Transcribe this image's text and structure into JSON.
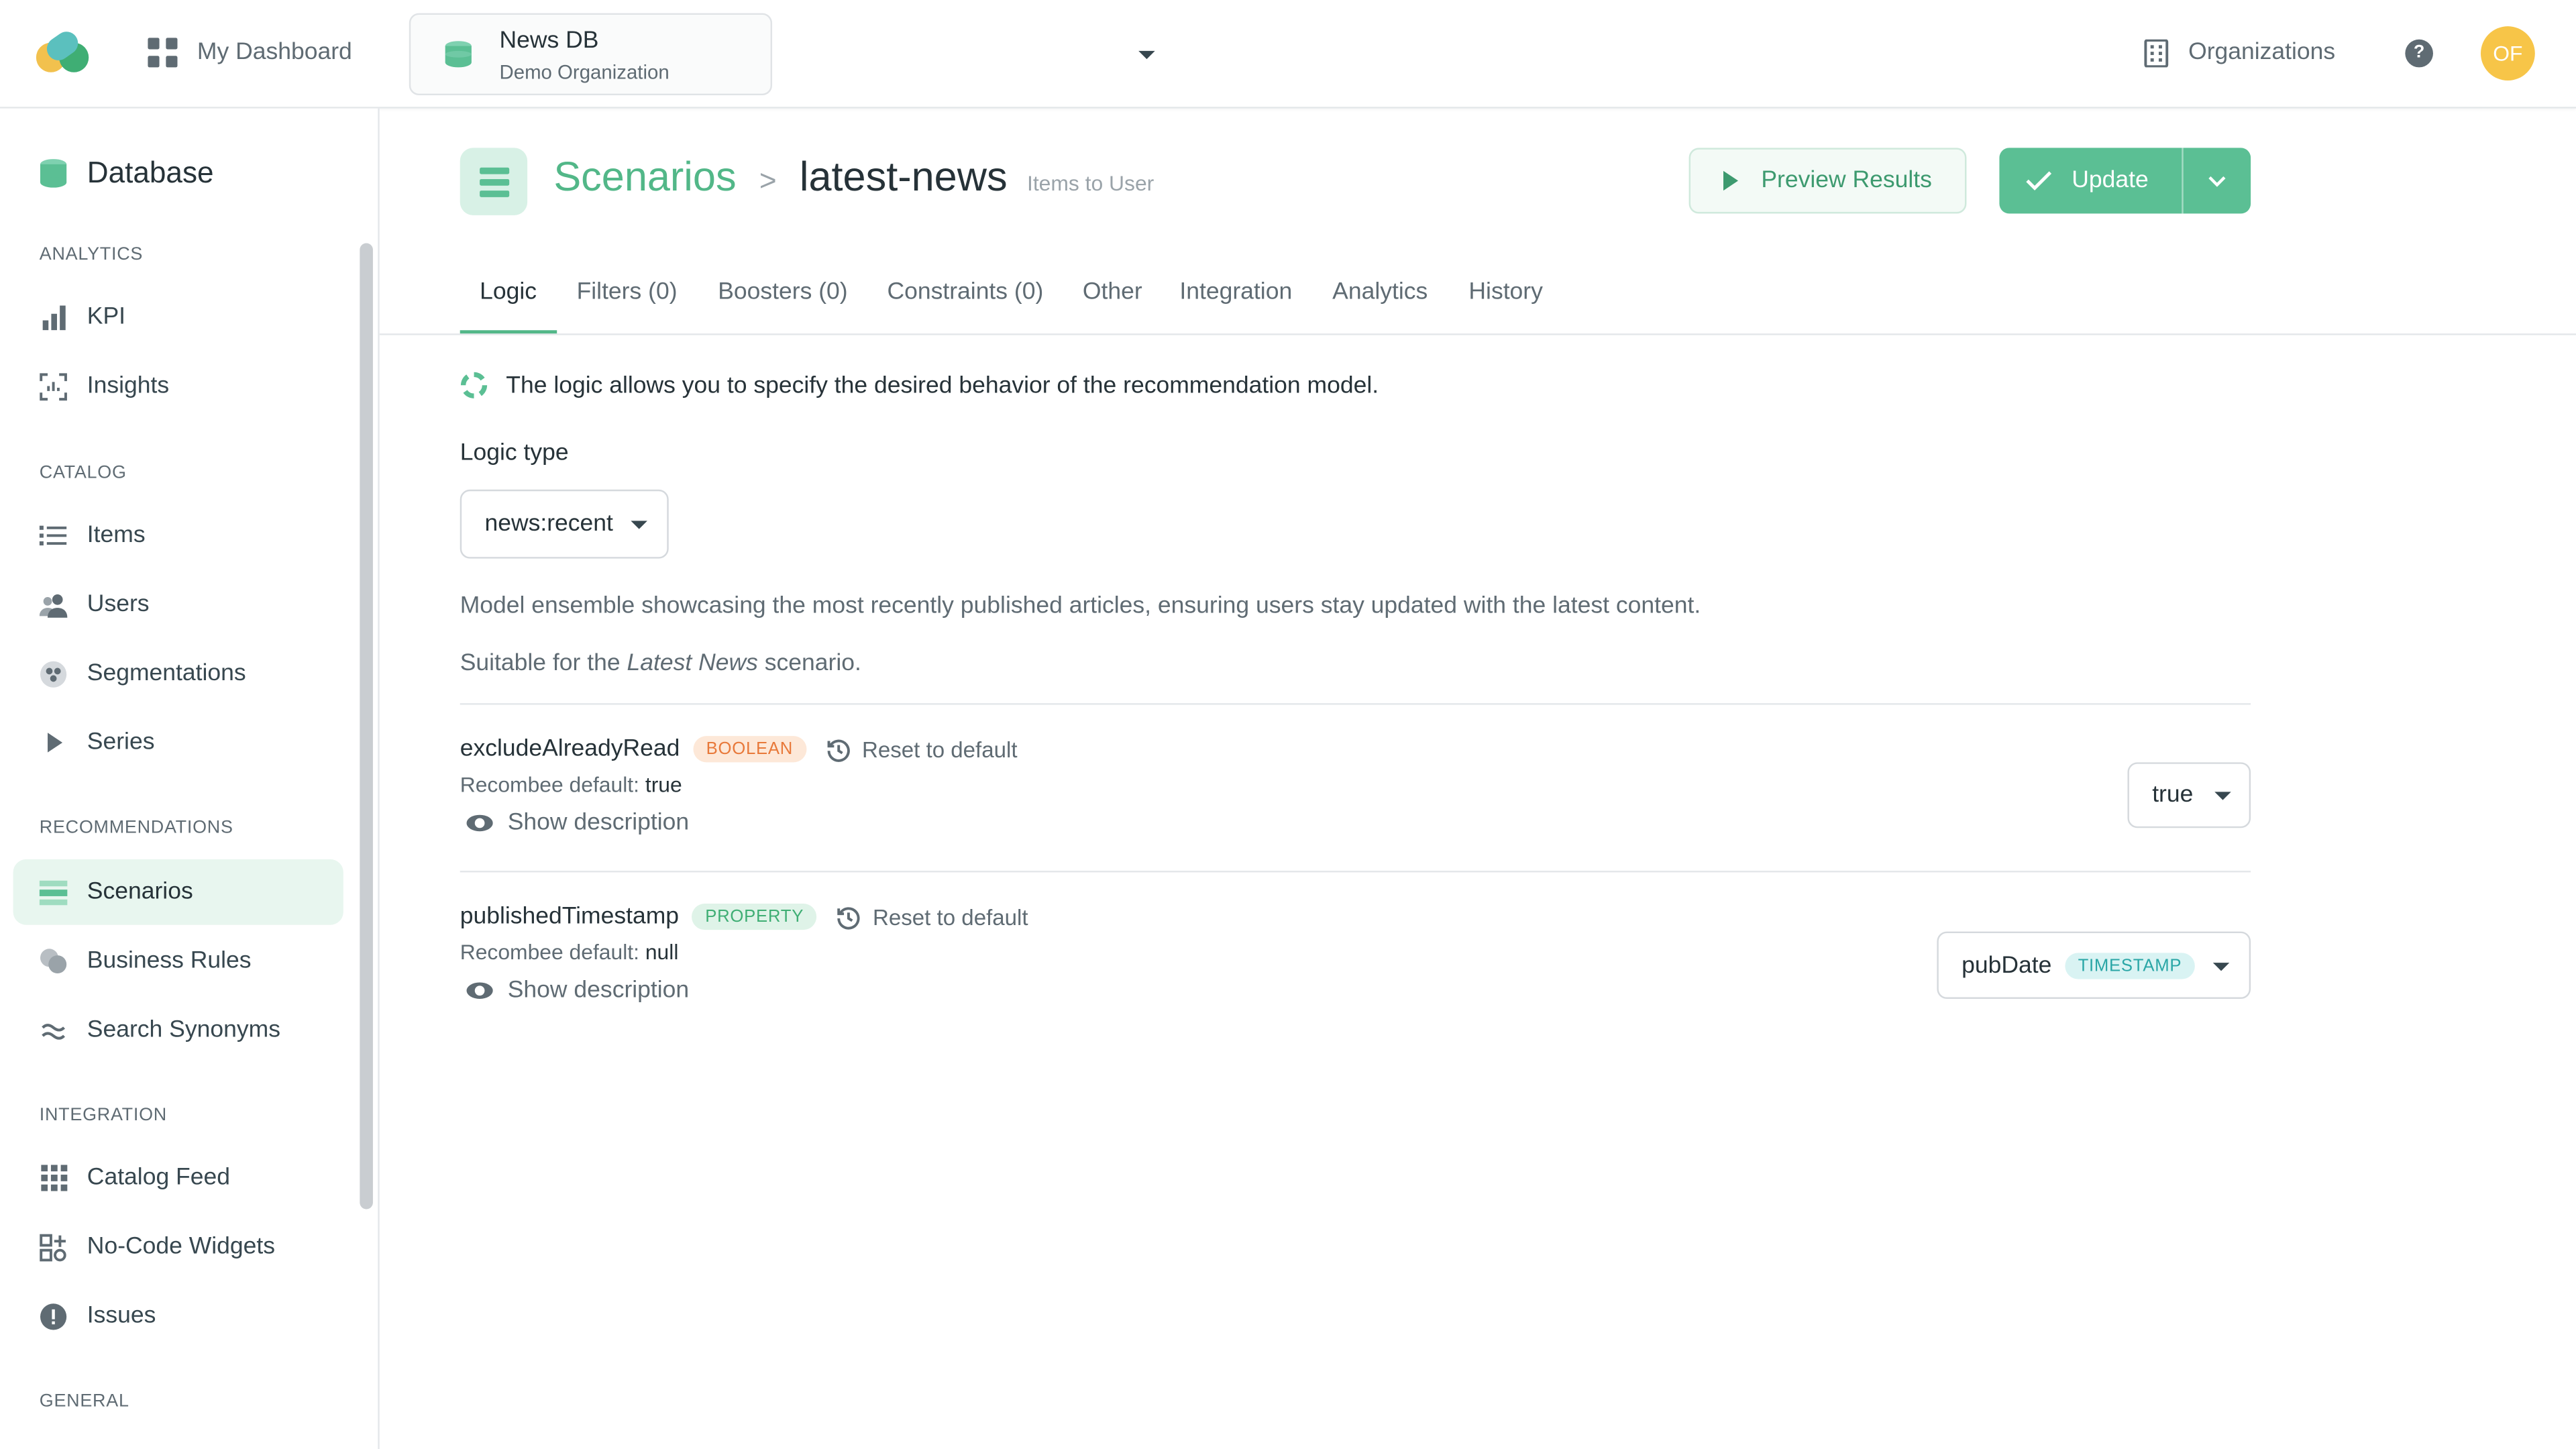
{
  "topbar": {
    "dashboard_label": "My Dashboard",
    "db_name": "News DB",
    "db_org": "Demo Organization",
    "organizations_label": "Organizations",
    "help_glyph": "?",
    "avatar_initials": "OF"
  },
  "colors": {
    "accent": "#52b788",
    "accent_button": "#5bbf94",
    "active_item_bg": "#e8f6ef",
    "boolean_badge": "#e8793a",
    "property_badge": "#3fae74",
    "timestamp_badge": "#2aa6a6",
    "avatar": "#f7c548"
  },
  "sidebar": {
    "title": "Database",
    "sections": {
      "analytics": "ANALYTICS",
      "catalog": "CATALOG",
      "recommendations": "RECOMMENDATIONS",
      "integration": "INTEGRATION",
      "general": "GENERAL"
    },
    "items": [
      {
        "label": "KPI",
        "icon": "bar-chart-icon"
      },
      {
        "label": "Insights",
        "icon": "insights-icon"
      },
      {
        "label": "Items",
        "icon": "list-icon"
      },
      {
        "label": "Users",
        "icon": "users-icon"
      },
      {
        "label": "Segmentations",
        "icon": "segments-icon"
      },
      {
        "label": "Series",
        "icon": "play-icon"
      },
      {
        "label": "Scenarios",
        "icon": "scenarios-icon",
        "active": true
      },
      {
        "label": "Business Rules",
        "icon": "rules-icon"
      },
      {
        "label": "Search Synonyms",
        "icon": "approx-icon"
      },
      {
        "label": "Catalog Feed",
        "icon": "grid-icon"
      },
      {
        "label": "No-Code Widgets",
        "icon": "widgets-icon"
      },
      {
        "label": "Issues",
        "icon": "alert-icon"
      }
    ]
  },
  "header": {
    "breadcrumb_root": "Scenarios",
    "breadcrumb_separator": ">",
    "title": "latest-news",
    "subtitle": "Items to User",
    "preview_label": "Preview Results",
    "update_label": "Update"
  },
  "tabs": [
    "Logic",
    "Filters (0)",
    "Boosters (0)",
    "Constraints (0)",
    "Other",
    "Integration",
    "Analytics",
    "History"
  ],
  "logic": {
    "info_text": "The logic allows you to specify the desired behavior of the recommendation model.",
    "type_label": "Logic type",
    "type_value": "news:recent",
    "description": "Model ensemble showcasing the most recently published articles, ensuring users stay updated with the latest content.",
    "suitable_prefix": "Suitable for the",
    "suitable_name": "Latest News",
    "suitable_suffix": "scenario."
  },
  "params": [
    {
      "name": "excludeAlreadyRead",
      "badge": "BOOLEAN",
      "reset_label": "Reset to default",
      "default_label": "Recombee default:",
      "default_value": "true",
      "show_desc": "Show description",
      "value": "true"
    },
    {
      "name": "publishedTimestamp",
      "badge": "PROPERTY",
      "reset_label": "Reset to default",
      "default_label": "Recombee default:",
      "default_value": "null",
      "show_desc": "Show description",
      "value": "pubDate",
      "value_badge": "TIMESTAMP"
    }
  ]
}
